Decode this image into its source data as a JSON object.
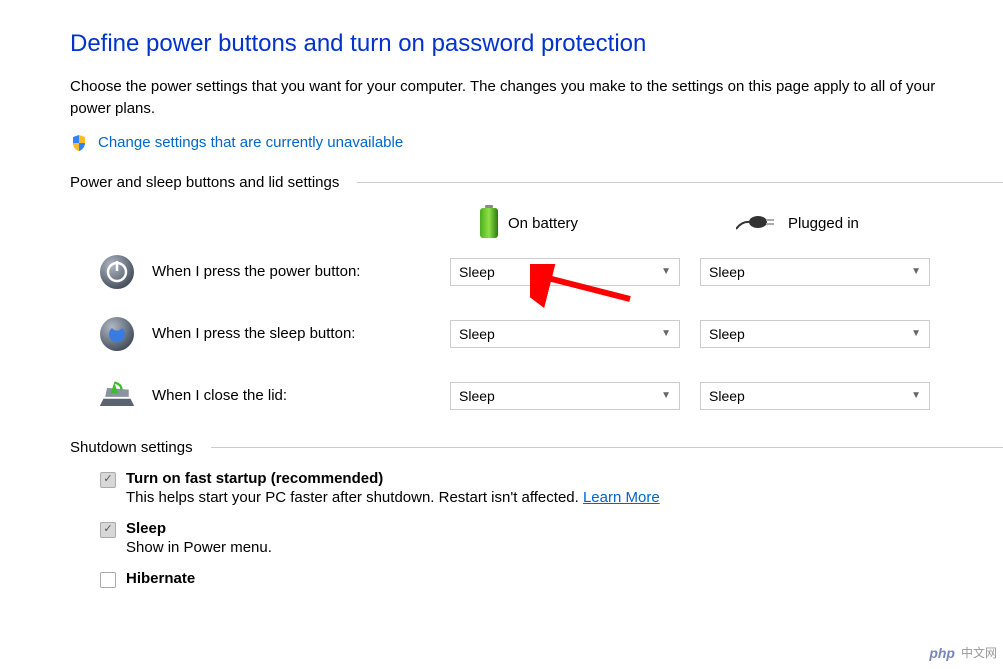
{
  "page": {
    "title": "Define power buttons and turn on password protection",
    "description": "Choose the power settings that you want for your computer. The changes you make to the settings on this page apply to all of your power plans.",
    "change_link": "Change settings that are currently unavailable"
  },
  "power_section": {
    "header": "Power and sleep buttons and lid settings",
    "columns": {
      "battery": "On battery",
      "plugged": "Plugged in"
    },
    "rows": [
      {
        "label": "When I press the power button:",
        "battery_value": "Sleep",
        "plugged_value": "Sleep"
      },
      {
        "label": "When I press the sleep button:",
        "battery_value": "Sleep",
        "plugged_value": "Sleep"
      },
      {
        "label": "When I close the lid:",
        "battery_value": "Sleep",
        "plugged_value": "Sleep"
      }
    ]
  },
  "shutdown_section": {
    "header": "Shutdown settings",
    "items": [
      {
        "title": "Turn on fast startup (recommended)",
        "sub": "This helps start your PC faster after shutdown. Restart isn't affected. ",
        "link": "Learn More",
        "checked": true
      },
      {
        "title": "Sleep",
        "sub": "Show in Power menu.",
        "checked": true
      },
      {
        "title": "Hibernate",
        "sub": "",
        "checked": false
      }
    ]
  },
  "watermark": "中文网"
}
